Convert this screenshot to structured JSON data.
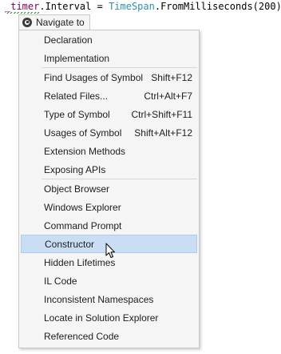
{
  "code": {
    "field": "_timer",
    "dot_member": ".Interval = ",
    "type_name": "TimeSpan",
    "method_call": ".FromMilliseconds(200);"
  },
  "header": {
    "icon": "navigate-icon",
    "label": "Navigate to"
  },
  "menu": {
    "groups": [
      {
        "items": [
          {
            "label": "Declaration",
            "shortcut": ""
          },
          {
            "label": "Implementation",
            "shortcut": ""
          }
        ]
      },
      {
        "items": [
          {
            "label": "Find Usages of Symbol",
            "shortcut": "Shift+F12"
          },
          {
            "label": "Related Files...",
            "shortcut": "Ctrl+Alt+F7"
          },
          {
            "label": "Type of Symbol",
            "shortcut": "Ctrl+Shift+F11"
          },
          {
            "label": "Usages of Symbol",
            "shortcut": "Shift+Alt+F12"
          },
          {
            "label": "Extension Methods",
            "shortcut": ""
          },
          {
            "label": "Exposing APIs",
            "shortcut": ""
          }
        ]
      },
      {
        "items": [
          {
            "label": "Object Browser",
            "shortcut": ""
          },
          {
            "label": "Windows Explorer",
            "shortcut": ""
          },
          {
            "label": "Command Prompt",
            "shortcut": ""
          },
          {
            "label": "Constructor",
            "shortcut": "",
            "highlighted": true
          },
          {
            "label": "Hidden Lifetimes",
            "shortcut": ""
          },
          {
            "label": "IL Code",
            "shortcut": ""
          },
          {
            "label": "Inconsistent Namespaces",
            "shortcut": ""
          },
          {
            "label": "Locate in Solution Explorer",
            "shortcut": ""
          },
          {
            "label": "Referenced Code",
            "shortcut": ""
          }
        ]
      }
    ]
  },
  "colors": {
    "highlight": "#c9def5",
    "menu_background": "#f5f5f5",
    "border": "#c8c8c8",
    "field_token": "#7f0055",
    "type_token": "#2b91af"
  }
}
